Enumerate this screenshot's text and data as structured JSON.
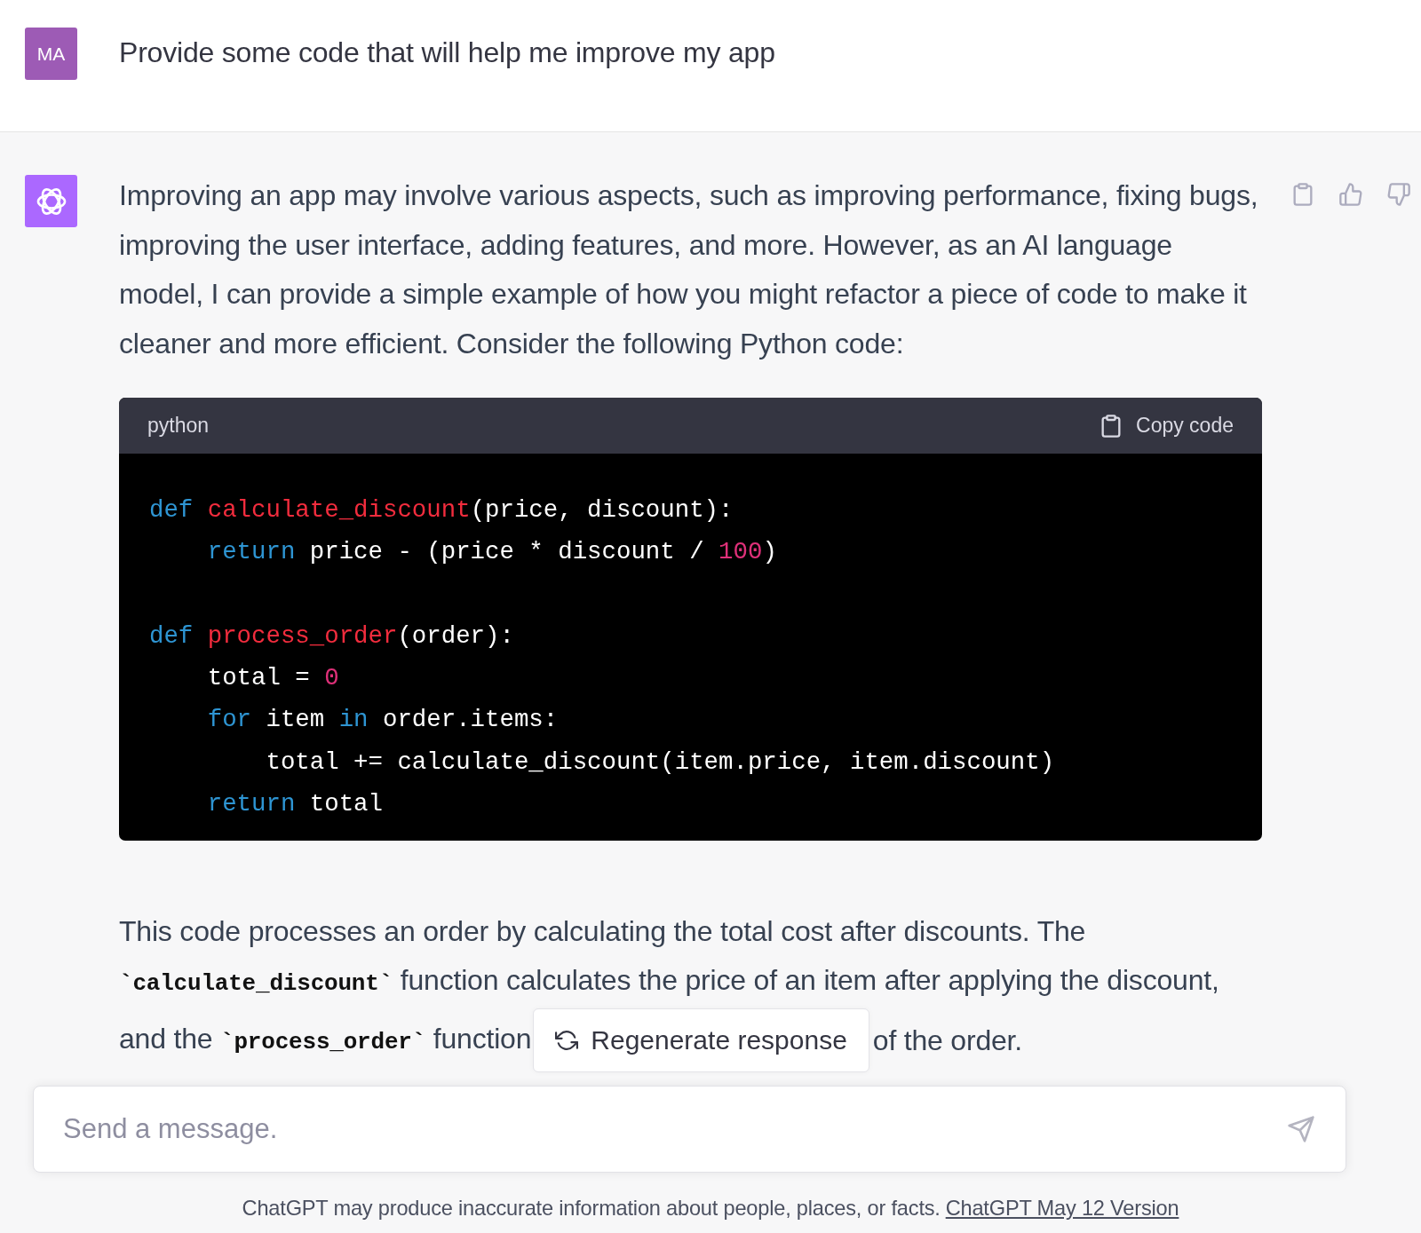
{
  "user_message": {
    "avatar": "MA",
    "text": "Provide some code that will help me improve my app"
  },
  "assistant_message": {
    "intro": "Improving an app may involve various aspects, such as improving performance, fixing bugs, improving the user interface, adding features, and more. However, as an AI language model, I can provide a simple example of how you might refactor a piece of code to make it cleaner and more efficient. Consider the following Python code:",
    "actions": [
      {
        "kind": "copy"
      },
      {
        "kind": "like"
      },
      {
        "kind": "dislike"
      }
    ],
    "code_block": {
      "language": "python",
      "copy_label": "Copy code",
      "blocks": [
        {
          "lines": [
            [
              {
                "kind": "keyword",
                "text": "def "
              },
              {
                "kind": "function",
                "text": "calculate_discount"
              },
              {
                "kind": "plain",
                "text": "(price, discount):"
              }
            ],
            [
              {
                "kind": "keyword",
                "text": "    return"
              },
              {
                "kind": "plain",
                "text": " price - (price * discount / "
              },
              {
                "kind": "number",
                "text": "100"
              },
              {
                "kind": "plain",
                "text": ")"
              }
            ]
          ]
        },
        {
          "lines": [
            [
              {
                "kind": "keyword",
                "text": "def "
              },
              {
                "kind": "function",
                "text": "process_order"
              },
              {
                "kind": "plain",
                "text": "(order):"
              }
            ],
            [
              {
                "kind": "plain",
                "text": "    total = "
              },
              {
                "kind": "number",
                "text": "0"
              }
            ],
            [
              {
                "kind": "keyword",
                "text": "    for"
              },
              {
                "kind": "plain",
                "text": " item "
              },
              {
                "kind": "keyword",
                "text": "in"
              },
              {
                "kind": "plain",
                "text": " order.items:"
              }
            ],
            [
              {
                "kind": "plain",
                "text": "        total += calculate_discount(item.price, item.discount)"
              }
            ],
            [
              {
                "kind": "keyword",
                "text": "    return"
              },
              {
                "kind": "plain",
                "text": " total"
              }
            ]
          ]
        }
      ]
    },
    "outro_lines": [
      [
        {
          "kind": "text",
          "text": "This code processes an order by calculating the total cost after discounts. The"
        }
      ],
      [
        {
          "kind": "code",
          "text": "`calculate_discount`"
        },
        {
          "kind": "text",
          "text": " function calculates the price of an item after applying the discount,"
        }
      ]
    ],
    "outro_last_left": [
      {
        "kind": "text",
        "text": "and the "
      },
      {
        "kind": "code",
        "text": "`process_order`"
      },
      {
        "kind": "text",
        "text": " function"
      }
    ],
    "outro_last_right": "of the order."
  },
  "regenerate_button": {
    "label": "Regenerate response"
  },
  "composer": {
    "placeholder": "Send a message."
  },
  "footer": {
    "text": "ChatGPT may produce inaccurate information about people, places, or facts.",
    "link": "ChatGPT May 12 Version"
  }
}
